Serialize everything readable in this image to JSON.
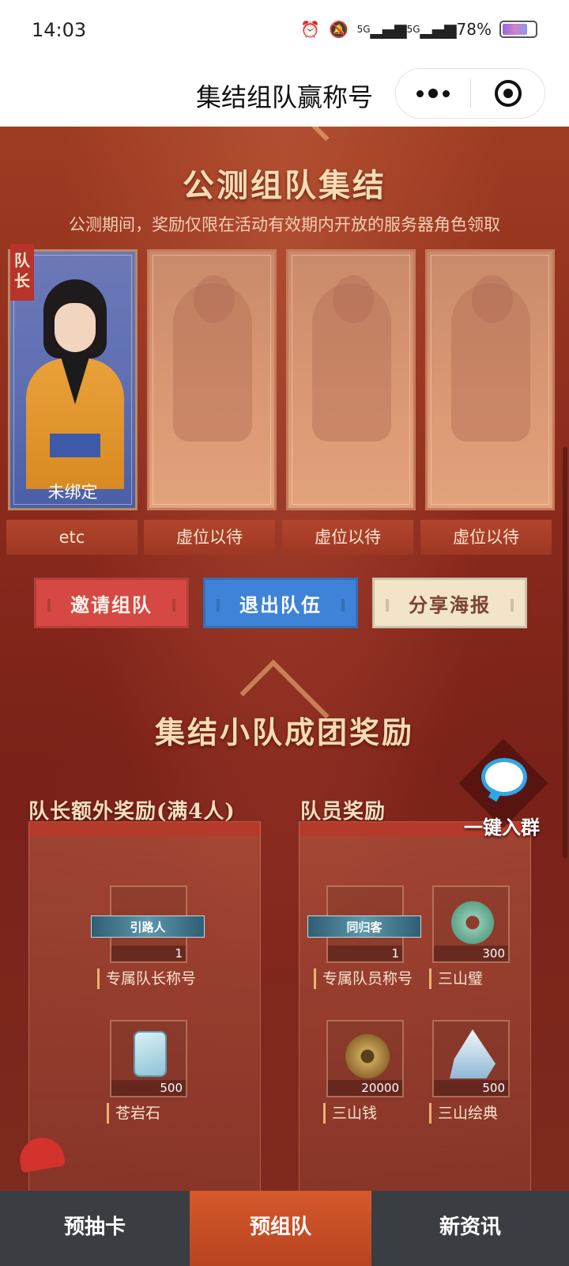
{
  "status_bar": {
    "time": "14:03",
    "signal_1": "5G",
    "signal_2": "5G",
    "battery": "78%",
    "battery_level": 0.78
  },
  "title_bar": {
    "title": "集结组队赢称号"
  },
  "team_section": {
    "title": "公测组队集结",
    "subtitle": "公测期间，奖励仅限在活动有效期内开放的服务器角色领取",
    "leader_badge": "队长",
    "leader_status": "未绑定",
    "members": [
      {
        "name": "etc"
      },
      {
        "name": "虚位以待"
      },
      {
        "name": "虚位以待"
      },
      {
        "name": "虚位以待"
      }
    ],
    "buttons": {
      "invite": "邀请组队",
      "quit": "退出队伍",
      "share": "分享海报"
    }
  },
  "reward_section": {
    "title": "集结小队成团奖励",
    "leader_heading": "队长额外奖励(满4人)",
    "member_heading": "队员奖励",
    "join_group": "一键入群",
    "leader_items": [
      {
        "banner": "引路人",
        "count": "1",
        "label": "专属队长称号"
      },
      {
        "count": "500",
        "label": "苍岩石"
      }
    ],
    "member_items": [
      {
        "banner": "同归客",
        "count": "1",
        "label": "专属队员称号"
      },
      {
        "count": "300",
        "label": "三山璧"
      },
      {
        "count": "20000",
        "label": "三山钱"
      },
      {
        "count": "500",
        "label": "三山绘典"
      }
    ]
  },
  "bottom_nav": {
    "tabs": [
      {
        "label": "预抽卡"
      },
      {
        "label": "预组队"
      },
      {
        "label": "新资讯"
      }
    ],
    "active_index": 1
  },
  "colors": {
    "accent_red": "#d54844",
    "accent_blue": "#3f83d8",
    "cream": "#f1e4c7",
    "nav_active": "#d55a2c"
  }
}
